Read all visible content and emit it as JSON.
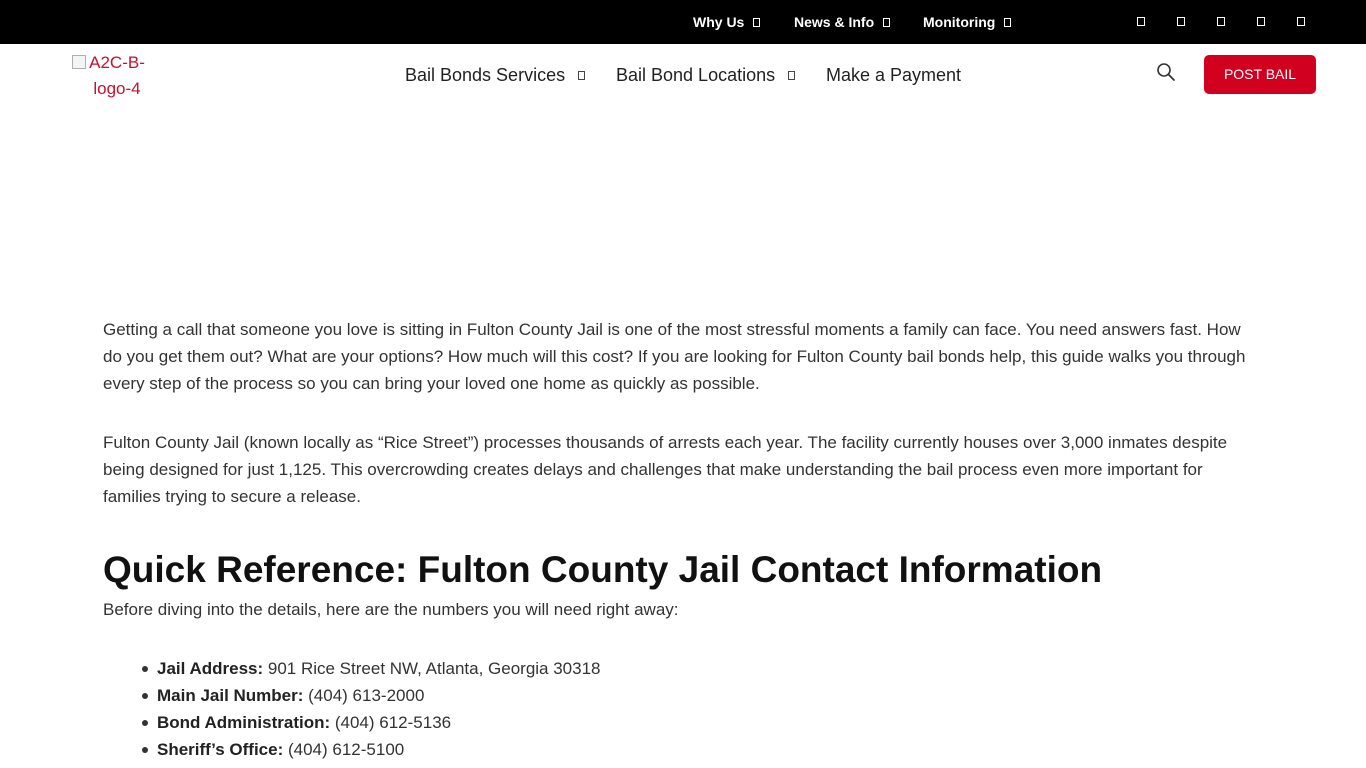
{
  "topbar": {
    "links": [
      {
        "label": "Why Us"
      },
      {
        "label": "News & Info"
      },
      {
        "label": "Monitoring"
      }
    ],
    "social_icons": [
      "facebook-icon",
      "twitter-icon",
      "instagram-icon",
      "youtube-icon",
      "linkedin-icon"
    ],
    "background": "#000000"
  },
  "header": {
    "logo_alt": "A2C-B-logo-4",
    "nav": [
      {
        "label": "Bail Bonds Services"
      },
      {
        "label": "Bail Bond Locations"
      },
      {
        "label": "Make a Payment"
      }
    ],
    "cta_label": "POST BAIL",
    "cta_color": "#d1001f"
  },
  "article": {
    "paragraphs": [
      "Getting a call that someone you love is sitting in Fulton County Jail is one of the most stressful moments a family can face. You need answers fast. How do you get them out? What are your options? How much will this cost? If you are looking for Fulton County bail bonds help, this guide walks you through every step of the process so you can bring your loved one home as quickly as possible.",
      "Fulton County Jail (known locally as “Rice Street”) processes thousands of arrests each year. The facility currently houses over 3,000 inmates despite being designed for just 1,125. This overcrowding creates delays and challenges that make understanding the bail process even more important for families trying to secure a release."
    ],
    "heading": "Quick Reference: Fulton County Jail Contact Information",
    "intro": "Before diving into the details, here are the numbers you will need right away:",
    "contacts": [
      {
        "label": "Jail Address:",
        "value": " 901 Rice Street NW, Atlanta, Georgia 30318"
      },
      {
        "label": "Main Jail Number:",
        "value": " (404) 613-2000"
      },
      {
        "label": "Bond Administration:",
        "value": " (404) 612-5136"
      },
      {
        "label": "Sheriff’s Office:",
        "value": " (404) 612-5100"
      }
    ]
  }
}
